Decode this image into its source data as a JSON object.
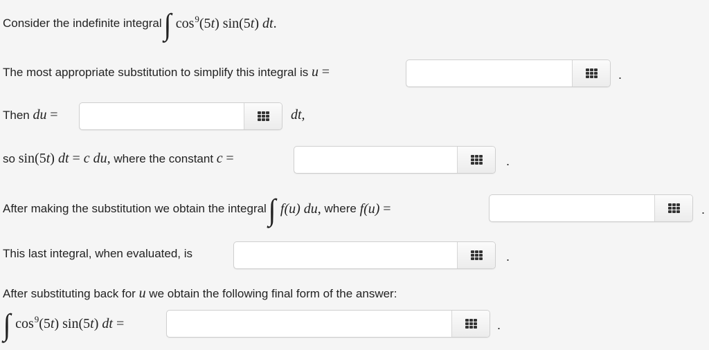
{
  "q1": {
    "prefix": "Consider the indefinite integral",
    "integrand_cos": "cos",
    "power": "9",
    "arg1": "(5",
    "t1": "t",
    "close1": ")",
    "sin": " sin(5",
    "t2": "t",
    "close2": ")",
    "dt": "dt",
    "end": "."
  },
  "q2": {
    "text": "The most appropriate substitution to simplify this integral is",
    "var": "u",
    "eq": "=",
    "input_value": "",
    "after": "."
  },
  "q3": {
    "text": "Then",
    "du": "du",
    "eq": "=",
    "input_value": "",
    "after": "dt,"
  },
  "q4": {
    "so": "so",
    "sin": "sin(5",
    "t": "t",
    "close": ")",
    "dt": "dt",
    "eq": "=",
    "c": "c",
    "du": "du",
    "comma": ",",
    "mid": "where the constant",
    "c2": "c",
    "eq2": "=",
    "input_value": "",
    "after": "."
  },
  "q5": {
    "text": "After making the substitution we obtain the integral",
    "fu": "f(u)",
    "du": "du",
    "comma": ",",
    "where": "where",
    "fu2": "f(u)",
    "eq": "=",
    "input_value": "",
    "after": "."
  },
  "q6": {
    "text": "This last integral, when evaluated, is",
    "input_value": "",
    "after": "."
  },
  "q7": {
    "text_a": "After substituting back for",
    "var": "u",
    "text_b": "we obtain the following final form of the answer:"
  },
  "q8": {
    "cos": "cos",
    "power": "9",
    "arg1": "(5",
    "t1": "t",
    "close1": ")",
    "sin": " sin(5",
    "t2": "t",
    "close2": ")",
    "dt": "dt",
    "eq": "=",
    "input_value": "",
    "after": "."
  },
  "icons": {
    "keypad": "keypad-grid-icon",
    "integral": "integral-sign"
  }
}
